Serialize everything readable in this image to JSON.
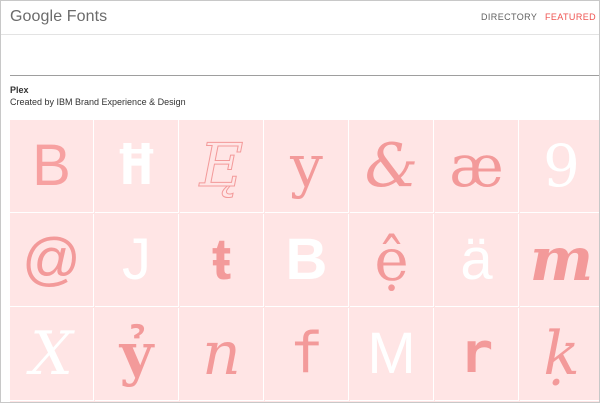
{
  "header": {
    "logo": "Google Fonts",
    "nav": {
      "directory": "DIRECTORY",
      "featured": "FEATURED"
    }
  },
  "font": {
    "name": "Plex",
    "credit": "Created by IBM Brand Experience & Design"
  },
  "glyphs": [
    [
      {
        "char": "B",
        "style": "sans",
        "weight": "normal",
        "color": "#f7a1a1"
      },
      {
        "char": "Ħ",
        "style": "mono",
        "weight": "bold",
        "color": "#ffffff"
      },
      {
        "char": "Ę",
        "style": "outline-italic",
        "weight": "normal",
        "color": "#f39a9a"
      },
      {
        "char": "y",
        "style": "serif",
        "weight": "normal",
        "color": "#f39a9a"
      },
      {
        "char": "&",
        "style": "serif-italic",
        "weight": "normal",
        "color": "#f39a9a"
      },
      {
        "char": "æ",
        "style": "serif",
        "weight": "normal",
        "color": "#f39a9a"
      },
      {
        "char": "9",
        "style": "serif",
        "weight": "normal",
        "color": "#ffffff"
      }
    ],
    [
      {
        "char": "@",
        "style": "sans",
        "weight": "normal",
        "color": "#f39a9a"
      },
      {
        "char": "J",
        "style": "sans",
        "weight": "normal",
        "color": "#ffffff"
      },
      {
        "char": "ŧ",
        "style": "sans",
        "weight": "bold",
        "color": "#f39a9a"
      },
      {
        "char": "B",
        "style": "sans",
        "weight": "bold",
        "color": "#ffffff"
      },
      {
        "char": "ệ",
        "style": "serif",
        "weight": "normal",
        "color": "#f39a9a"
      },
      {
        "char": "ä",
        "style": "sans",
        "weight": "normal",
        "color": "#ffffff"
      },
      {
        "char": "m",
        "style": "serif-italic",
        "weight": "bold",
        "color": "#f39a9a"
      }
    ],
    [
      {
        "char": "X",
        "style": "serif-italic",
        "weight": "normal",
        "color": "#ffffff"
      },
      {
        "char": "ỷ",
        "style": "serif",
        "weight": "bold",
        "color": "#f39a9a"
      },
      {
        "char": "n",
        "style": "serif-italic",
        "weight": "normal",
        "color": "#f39a9a"
      },
      {
        "char": "f",
        "style": "mono",
        "weight": "normal",
        "color": "#f39a9a"
      },
      {
        "char": "M",
        "style": "sans",
        "weight": "normal",
        "color": "#ffffff"
      },
      {
        "char": "r",
        "style": "mono",
        "weight": "bold",
        "color": "#f39a9a"
      },
      {
        "char": "ḳ",
        "style": "serif-italic",
        "weight": "normal",
        "color": "#f39a9a"
      }
    ]
  ],
  "colors": {
    "accent": "#ef5350",
    "tile_bg": "#ffe5e5",
    "glyph_pink": "#f39a9a",
    "glyph_white": "#ffffff"
  }
}
